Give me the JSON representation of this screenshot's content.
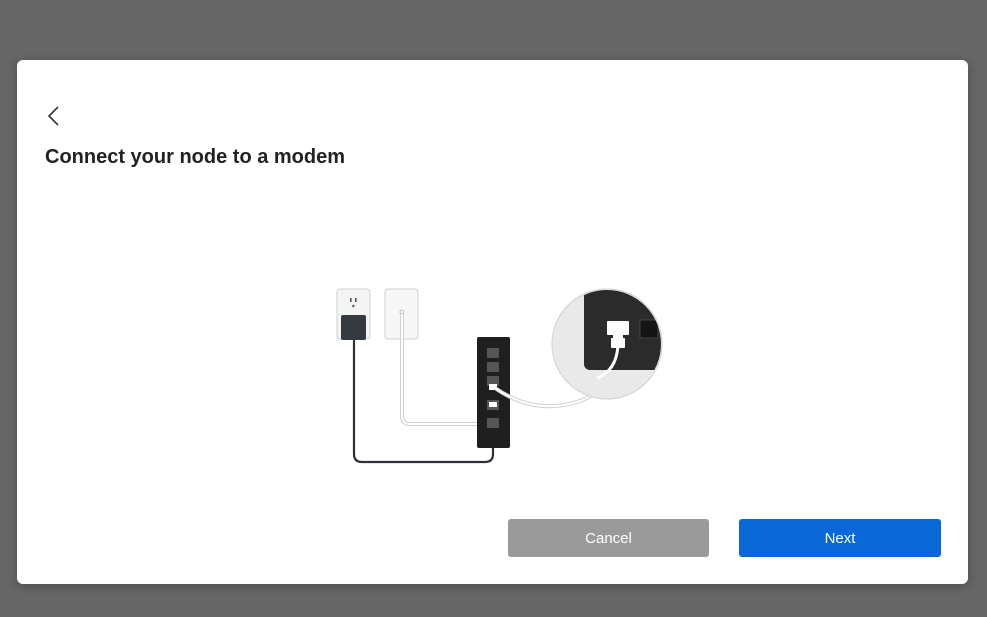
{
  "dialog": {
    "title": "Connect your node to a modem",
    "back_icon": "chevron-left-icon",
    "illustration_icon": "node-modem-connection-illustration",
    "cancel_label": "Cancel",
    "next_label": "Next"
  },
  "colors": {
    "overlay": "#666666",
    "dialog_bg": "#ffffff",
    "cancel_bg": "#9a9a9a",
    "next_bg": "#0a67d8",
    "title": "#222222"
  }
}
